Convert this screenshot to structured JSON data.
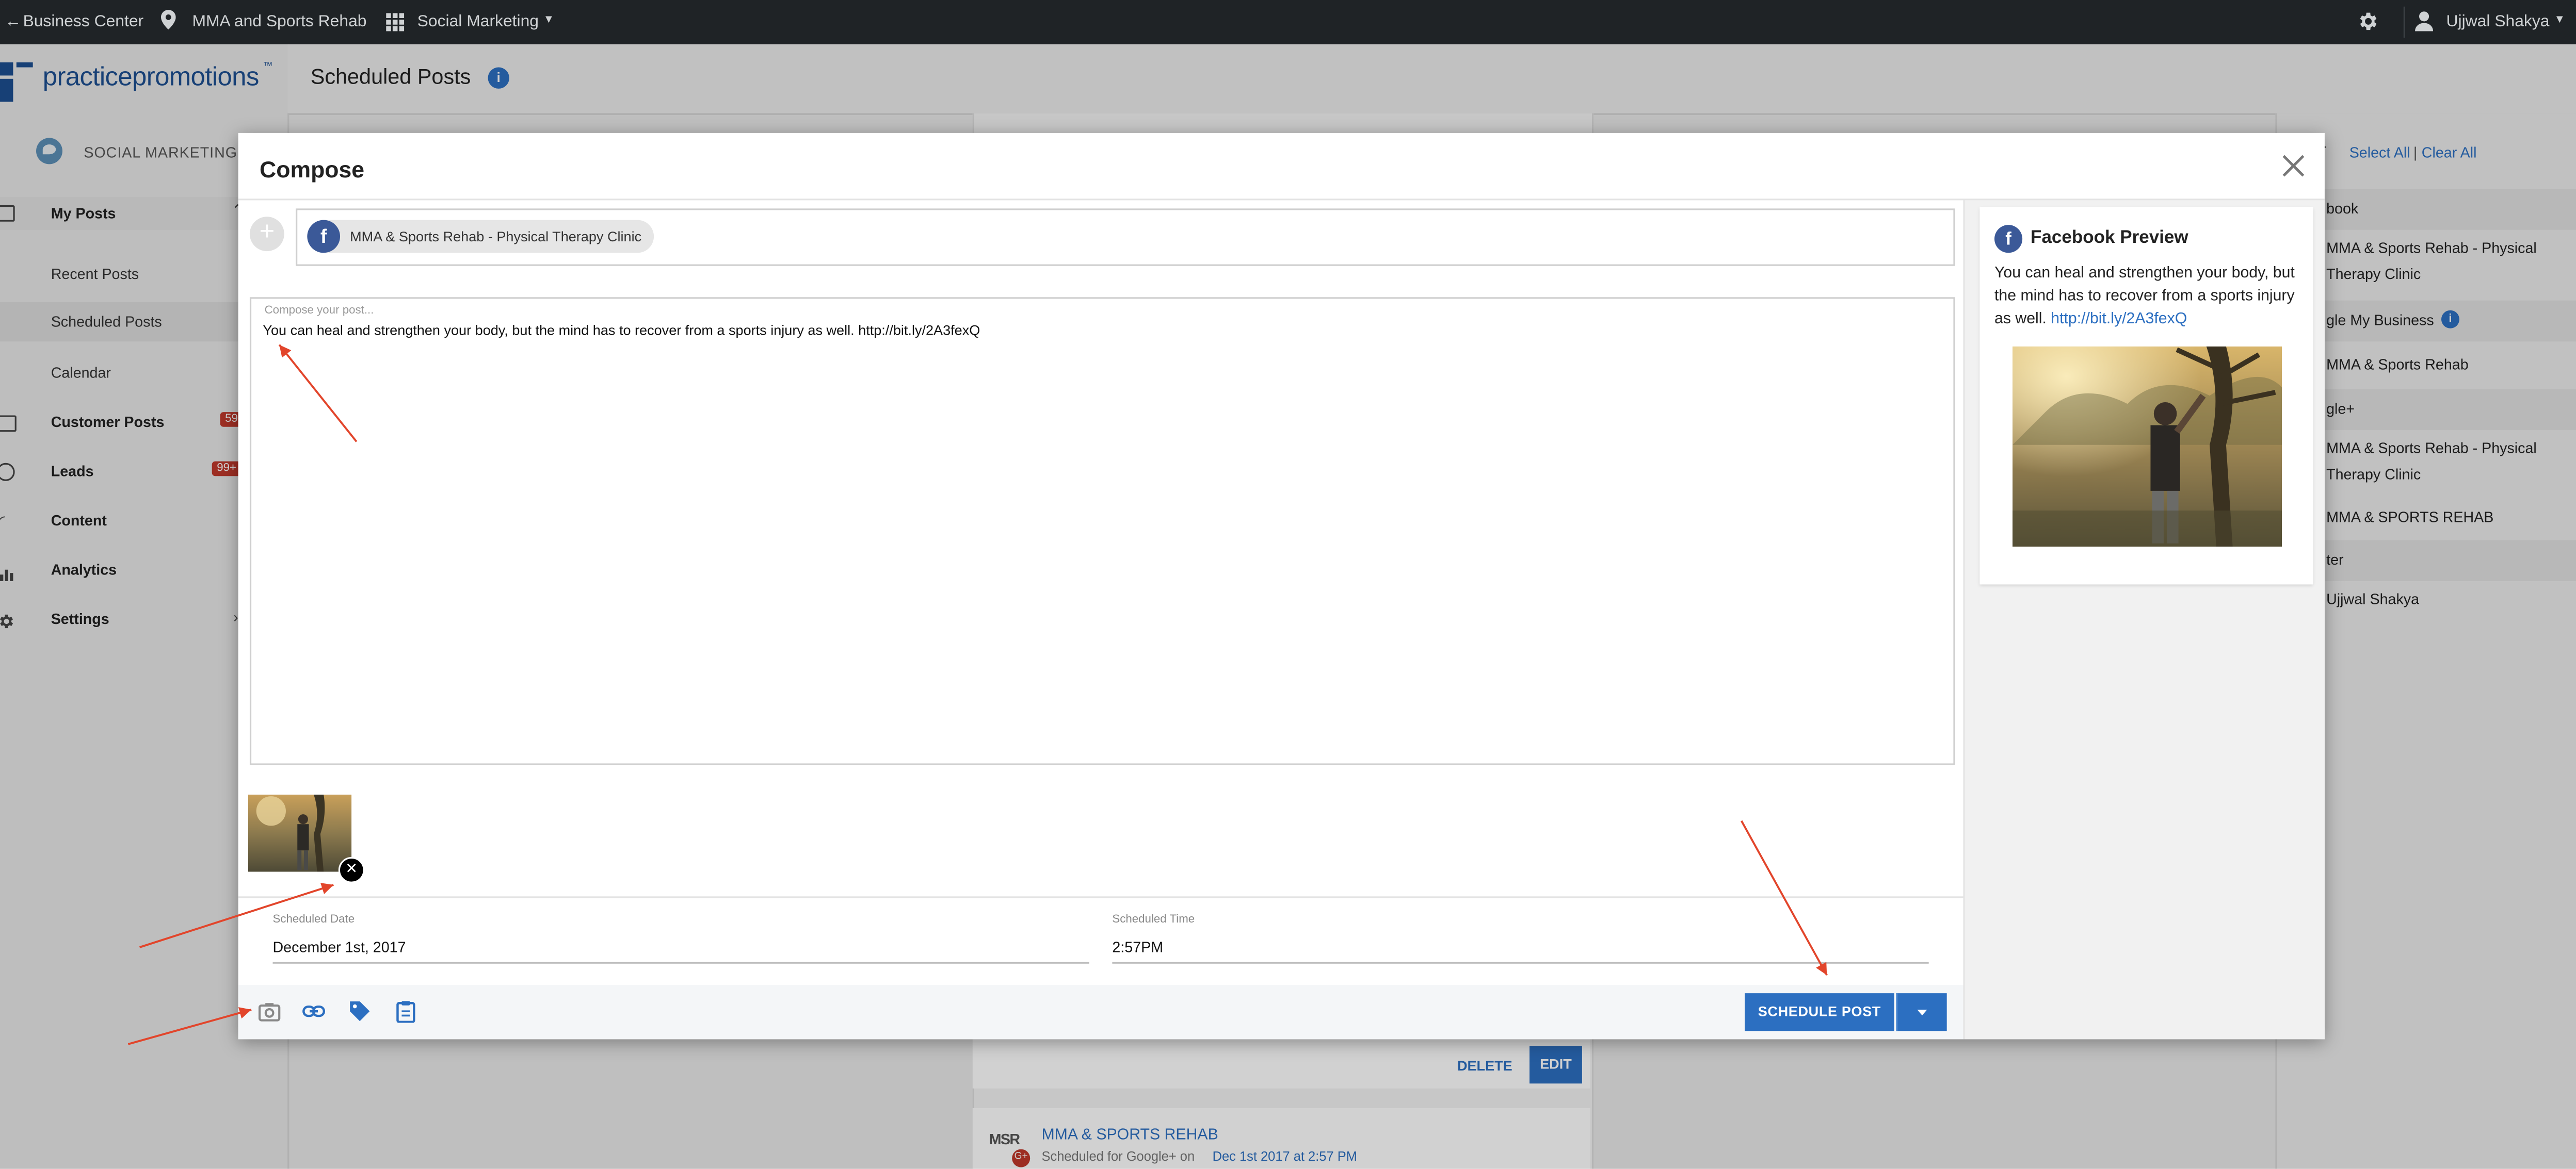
{
  "topbar": {
    "business_center": "Business Center",
    "location": "MMA and Sports Rehab",
    "app": "Social Marketing",
    "user": "Ujjwal Shakya"
  },
  "brand": {
    "logo_text": "practicepromotions",
    "section": "SOCIAL MARKETING"
  },
  "header": {
    "title": "Scheduled Posts"
  },
  "sidebar": {
    "items": [
      {
        "label": "My Posts"
      },
      {
        "label": "Recent Posts"
      },
      {
        "label": "Scheduled Posts"
      },
      {
        "label": "Calendar"
      },
      {
        "label": "Customer Posts",
        "badge": "59"
      },
      {
        "label": "Leads",
        "badge": "99+"
      },
      {
        "label": "Content"
      },
      {
        "label": "Analytics"
      },
      {
        "label": "Settings"
      }
    ]
  },
  "right_panel": {
    "header_partial": "er",
    "select_all": "Select All",
    "separator": "|",
    "clear_all": "Clear All",
    "rows": [
      "book",
      "MMA & Sports Rehab - Physical",
      "Therapy Clinic",
      "gle My Business",
      "MMA & Sports Rehab",
      "gle+",
      "MMA & Sports Rehab - Physical",
      "Therapy Clinic",
      "MMA & SPORTS REHAB",
      "ter",
      "Ujjwal Shakya"
    ]
  },
  "compose": {
    "title": "Compose",
    "recipient_chip": "MMA & Sports Rehab - Physical Therapy Clinic",
    "placeholder": "Compose your post...",
    "text": "You can heal and strengthen your body, but the mind has to recover from a sports injury as well.  http://bit.ly/2A3fexQ",
    "scheduled_date_label": "Scheduled Date",
    "scheduled_date": "December 1st, 2017",
    "scheduled_time_label": "Scheduled Time",
    "scheduled_time": "2:57PM",
    "schedule_button": "SCHEDULE POST"
  },
  "preview": {
    "title": "Facebook Preview",
    "text": "You can heal and strengthen your body, but the mind has to recover from a sports injury as well.",
    "link": "http://bit.ly/2A3fexQ"
  },
  "post_below": {
    "delete": "DELETE",
    "edit": "EDIT",
    "account": "MMA & SPORTS REHAB",
    "scheduled_prefix": "Scheduled for Google+ on",
    "scheduled_when": "Dec 1st 2017 at 2:57 PM",
    "avatar_text": "MSR"
  },
  "colors": {
    "accent": "#2c6fc1",
    "topbar": "#1f2326",
    "facebook": "#3b5998",
    "annotation_arrow": "#e2452b",
    "badge": "#c0392b"
  }
}
